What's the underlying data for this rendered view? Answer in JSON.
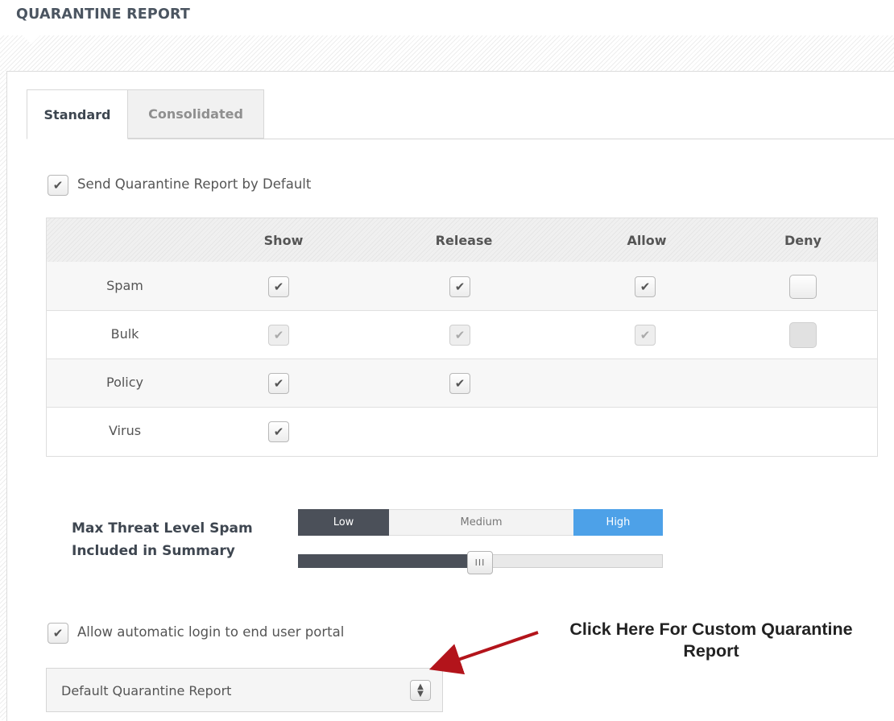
{
  "page": {
    "title": "QUARANTINE REPORT"
  },
  "tabs": [
    {
      "label": "Standard",
      "active": true
    },
    {
      "label": "Consolidated",
      "active": false
    }
  ],
  "send_default": {
    "label": "Send Quarantine Report by Default",
    "checked": true
  },
  "grid": {
    "columns": [
      "Show",
      "Release",
      "Allow",
      "Deny"
    ],
    "rows": [
      {
        "label": "Spam",
        "show": "checked",
        "release": "checked",
        "allow": "checked",
        "deny": "unchecked"
      },
      {
        "label": "Bulk",
        "show": "checked-disabled",
        "release": "checked-disabled",
        "allow": "checked-disabled",
        "deny": "unchecked-disabled"
      },
      {
        "label": "Policy",
        "show": "checked",
        "release": "checked",
        "allow": "none",
        "deny": "none"
      },
      {
        "label": "Virus",
        "show": "checked",
        "release": "none",
        "allow": "none",
        "deny": "none"
      }
    ]
  },
  "threat": {
    "label_line1": "Max Threat Level Spam",
    "label_line2": "Included in Summary",
    "levels": [
      "Low",
      "Medium",
      "High"
    ],
    "handle_glyph": "III",
    "slider_level_fraction": 0.5
  },
  "auto_login": {
    "label": "Allow automatic login to end user portal",
    "checked": true
  },
  "report_select": {
    "value": "Default Quarantine Report"
  },
  "annotation": {
    "line1": "Click Here For Custom Quarantine",
    "line2": "Report",
    "arrow_color": "#b3141b"
  },
  "colors": {
    "dark": "#4b5059",
    "accent": "#4da1e8"
  }
}
